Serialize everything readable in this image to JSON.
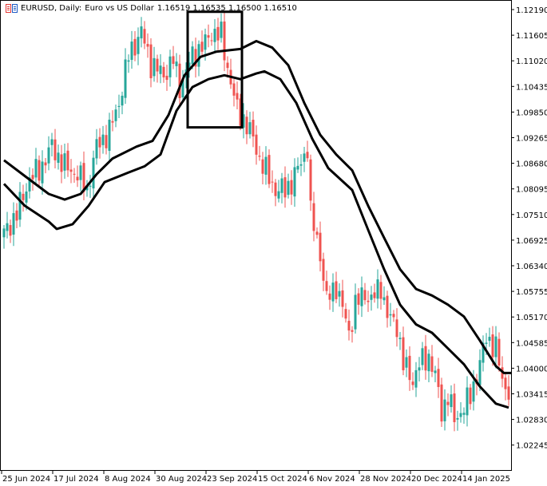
{
  "header": {
    "symbol": "EURUSD, Daily:",
    "description": "Euro vs US Dollar",
    "ohlc": "1.16519 1.16535 1.16500 1.16510"
  },
  "colors": {
    "bull": "#26a69a",
    "bear": "#ef5350",
    "ma": "#000000",
    "axis": "#000000"
  },
  "chart_data": {
    "type": "candlestick",
    "title": "EURUSD, Daily: Euro vs US Dollar",
    "candle_count": 159,
    "ylim": [
      1.0165,
      1.124
    ],
    "y_ticks": [
      "1.12190",
      "1.11605",
      "1.11020",
      "1.10435",
      "1.09850",
      "1.09265",
      "1.08680",
      "1.08095",
      "1.07510",
      "1.06925",
      "1.06340",
      "1.05755",
      "1.05170",
      "1.04585",
      "1.04000",
      "1.03415",
      "1.02830",
      "1.02245"
    ],
    "x_ticks": [
      {
        "index": 0,
        "label": "25 Jun 2024"
      },
      {
        "index": 16,
        "label": "17 Jul 2024"
      },
      {
        "index": 32,
        "label": "8 Aug 2024"
      },
      {
        "index": 48,
        "label": "30 Aug 2024"
      },
      {
        "index": 64,
        "label": "23 Sep 2024"
      },
      {
        "index": 80,
        "label": "15 Oct 2024"
      },
      {
        "index": 96,
        "label": "6 Nov 2024"
      },
      {
        "index": 112,
        "label": "28 Nov 2024"
      },
      {
        "index": 128,
        "label": "20 Dec 2024"
      },
      {
        "index": 144,
        "label": "14 Jan 2025"
      }
    ],
    "close_anchors": [
      [
        0,
        1.0707
      ],
      [
        4,
        1.0753
      ],
      [
        8,
        1.0834
      ],
      [
        11,
        1.0852
      ],
      [
        15,
        1.0906
      ],
      [
        19,
        1.0861
      ],
      [
        23,
        1.0843
      ],
      [
        26,
        1.0807
      ],
      [
        29,
        1.0906
      ],
      [
        33,
        1.0942
      ],
      [
        36,
        1.1006
      ],
      [
        39,
        1.1114
      ],
      [
        43,
        1.1168
      ],
      [
        46,
        1.1096
      ],
      [
        50,
        1.1069
      ],
      [
        53,
        1.1105
      ],
      [
        55,
        1.1042
      ],
      [
        59,
        1.1114
      ],
      [
        63,
        1.1141
      ],
      [
        65,
        1.1168
      ],
      [
        68,
        1.1159
      ],
      [
        70,
        1.1087
      ],
      [
        73,
        1.0988
      ],
      [
        75,
        1.097
      ],
      [
        78,
        1.0924
      ],
      [
        80,
        1.0879
      ],
      [
        83,
        1.0834
      ],
      [
        85,
        1.0807
      ],
      [
        88,
        1.0807
      ],
      [
        90,
        1.0825
      ],
      [
        93,
        1.087
      ],
      [
        95,
        1.0906
      ],
      [
        96,
        1.0753
      ],
      [
        99,
        1.0662
      ],
      [
        101,
        1.0554
      ],
      [
        104,
        1.059
      ],
      [
        106,
        1.0536
      ],
      [
        108,
        1.0481
      ],
      [
        110,
        1.0545
      ],
      [
        113,
        1.0572
      ],
      [
        115,
        1.0554
      ],
      [
        118,
        1.059
      ],
      [
        120,
        1.0518
      ],
      [
        123,
        1.05
      ],
      [
        125,
        1.0409
      ],
      [
        128,
        1.0373
      ],
      [
        130,
        1.0409
      ],
      [
        133,
        1.0427
      ],
      [
        135,
        1.0382
      ],
      [
        137,
        1.0301
      ],
      [
        139,
        1.0337
      ],
      [
        141,
        1.0283
      ],
      [
        144,
        1.031
      ],
      [
        146,
        1.0337
      ],
      [
        149,
        1.0409
      ],
      [
        151,
        1.0472
      ],
      [
        154,
        1.0445
      ],
      [
        156,
        1.0373
      ],
      [
        158,
        1.0346
      ]
    ],
    "series": [
      {
        "name": "ma-upper",
        "points": [
          [
            0,
            1.0875
          ],
          [
            6.5,
            1.0839
          ],
          [
            14,
            1.0798
          ],
          [
            19,
            1.0785
          ],
          [
            24,
            1.0798
          ],
          [
            29,
            1.0843
          ],
          [
            34,
            1.0879
          ],
          [
            41.5,
            1.0906
          ],
          [
            46.5,
            1.0919
          ],
          [
            51.5,
            1.0978
          ],
          [
            56.5,
            1.1069
          ],
          [
            61.5,
            1.1111
          ],
          [
            66.5,
            1.1123
          ],
          [
            71.5,
            1.1127
          ],
          [
            74,
            1.1129
          ],
          [
            79,
            1.1147
          ],
          [
            84,
            1.1132
          ],
          [
            89,
            1.1092
          ],
          [
            94,
            1.1006
          ],
          [
            99,
            1.0933
          ],
          [
            104,
            1.0888
          ],
          [
            109,
            1.0852
          ],
          [
            114,
            1.0771
          ],
          [
            119,
            1.0698
          ],
          [
            124,
            1.0626
          ],
          [
            129,
            1.0581
          ],
          [
            134,
            1.0566
          ],
          [
            139,
            1.0545
          ],
          [
            144,
            1.0518
          ],
          [
            149,
            1.0463
          ],
          [
            154,
            1.0405
          ],
          [
            156.5,
            1.0389
          ],
          [
            159,
            1.0389
          ]
        ]
      },
      {
        "name": "ma-lower",
        "points": [
          [
            0,
            1.0821
          ],
          [
            6.5,
            1.0771
          ],
          [
            14,
            1.0735
          ],
          [
            16.5,
            1.0718
          ],
          [
            21.5,
            1.0729
          ],
          [
            26.5,
            1.0771
          ],
          [
            31.5,
            1.0825
          ],
          [
            39,
            1.0847
          ],
          [
            44,
            1.0861
          ],
          [
            49,
            1.0888
          ],
          [
            54,
            1.0988
          ],
          [
            59,
            1.1042
          ],
          [
            64,
            1.106
          ],
          [
            69,
            1.1069
          ],
          [
            74,
            1.106
          ],
          [
            79,
            1.1073
          ],
          [
            81.5,
            1.1078
          ],
          [
            86.5,
            1.106
          ],
          [
            91.5,
            1.1006
          ],
          [
            96.5,
            1.0924
          ],
          [
            101.5,
            1.0857
          ],
          [
            109,
            1.0807
          ],
          [
            114,
            1.0716
          ],
          [
            119,
            1.0626
          ],
          [
            124,
            1.0545
          ],
          [
            129,
            1.05
          ],
          [
            134,
            1.0481
          ],
          [
            139,
            1.0445
          ],
          [
            144,
            1.0409
          ],
          [
            149,
            1.0358
          ],
          [
            154,
            1.0319
          ],
          [
            158,
            1.031
          ]
        ]
      }
    ],
    "rectangle": {
      "index_from": 57.5,
      "index_to": 74.5,
      "price_top": 1.1214,
      "price_bottom": 1.095
    },
    "grid": false,
    "legend": "none"
  }
}
